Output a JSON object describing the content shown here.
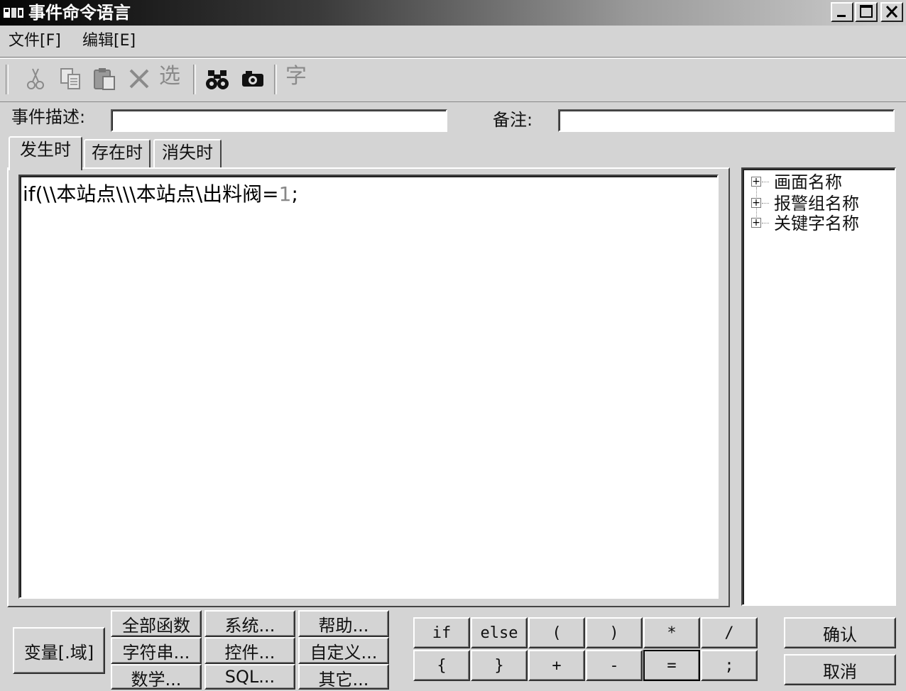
{
  "window": {
    "title": "事件命令语言"
  },
  "menu": {
    "file": "文件[F]",
    "edit": "编辑[E]"
  },
  "toolbar": {
    "select_label": "选",
    "char_label": "字"
  },
  "form": {
    "desc_label": "事件描述:",
    "desc_value": "",
    "note_label": "备注:",
    "note_value": ""
  },
  "tabs": [
    "发生时",
    "存在时",
    "消失时"
  ],
  "editor": {
    "code_text": "if(\\\\本站点\\\\\\本站点\\出料阀=",
    "code_number": "1",
    "code_end": ";"
  },
  "tree": [
    "画面名称",
    "报警组名称",
    "关键字名称"
  ],
  "buttons": {
    "var": "变量[.域]",
    "all_func": "全部函数",
    "system": "系统...",
    "help": "帮助...",
    "string": "字符串...",
    "control": "控件...",
    "custom": "自定义...",
    "math": "数学...",
    "sql": "SQL...",
    "other": "其它..."
  },
  "ops_row1": [
    "if",
    "else",
    "(",
    ")",
    "*",
    "/"
  ],
  "ops_row2": [
    "{",
    "}",
    "+",
    "-",
    "=",
    ";"
  ],
  "actions": {
    "ok": "确认",
    "cancel": "取消"
  }
}
